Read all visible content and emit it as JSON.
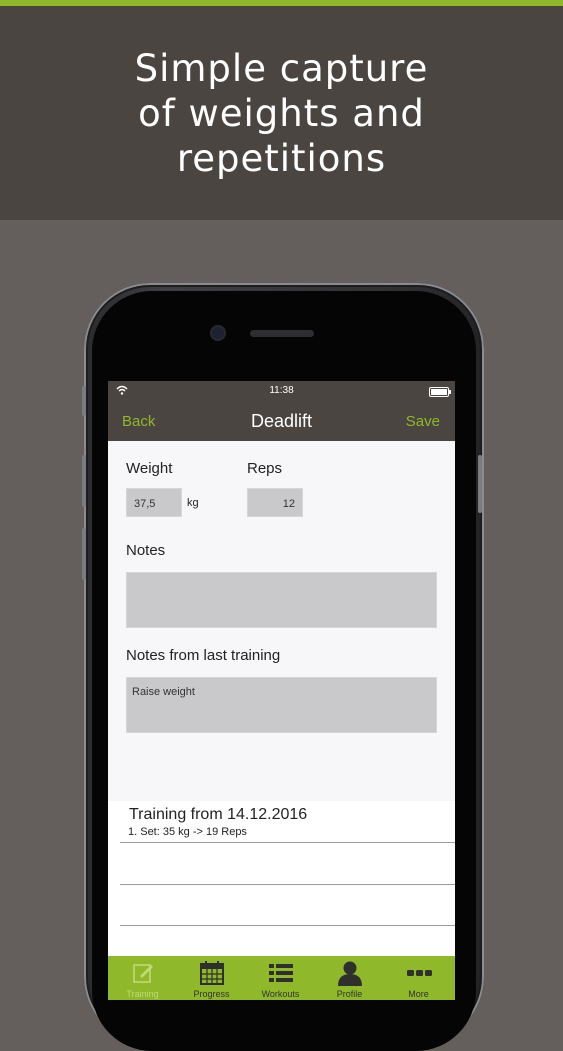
{
  "banner": {
    "headline_lines": [
      "Simple capture",
      "of weights and",
      "repetitions"
    ]
  },
  "status_bar": {
    "time": "11:38"
  },
  "nav": {
    "back_label": "Back",
    "title": "Deadlift",
    "save_label": "Save"
  },
  "form": {
    "weight_label": "Weight",
    "weight_value": "37,5",
    "weight_unit": "kg",
    "reps_label": "Reps",
    "reps_value": "12",
    "notes_label": "Notes",
    "notes_value": "",
    "last_notes_label": "Notes from last training",
    "last_notes_value": "Raise weight"
  },
  "history": {
    "title": "Training from 14.12.2016",
    "sets": [
      "1. Set: 35 kg -> 19 Reps"
    ]
  },
  "tabs": [
    {
      "label": "Training",
      "icon": "training-icon",
      "active": true
    },
    {
      "label": "Progress",
      "icon": "calendar-icon",
      "active": false
    },
    {
      "label": "Workouts",
      "icon": "list-icon",
      "active": false
    },
    {
      "label": "Profile",
      "icon": "profile-icon",
      "active": false
    },
    {
      "label": "More",
      "icon": "more-icon",
      "active": false
    }
  ],
  "colors": {
    "accent": "#8fb82a",
    "header": "#4b4541",
    "background": "#645f5c"
  }
}
